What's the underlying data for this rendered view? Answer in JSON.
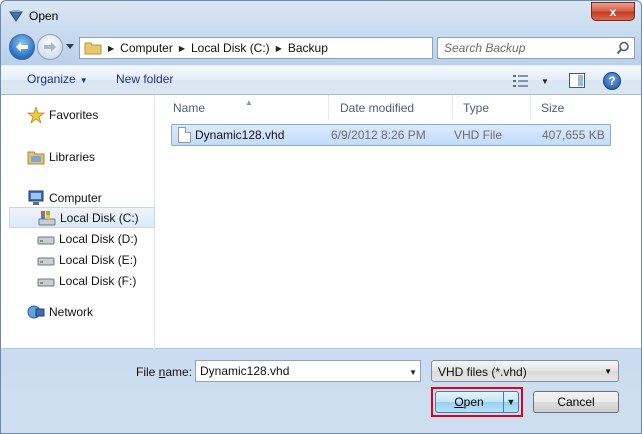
{
  "window": {
    "title": "Open",
    "close_glyph": "x"
  },
  "nav": {
    "back_icon": "back-arrow-icon",
    "breadcrumb": [
      "Computer",
      "Local Disk (C:)",
      "Backup"
    ],
    "search_placeholder": "Search Backup"
  },
  "toolbar": {
    "organize": "Organize",
    "new_folder": "New folder"
  },
  "sidebar": {
    "favorites": "Favorites",
    "libraries": "Libraries",
    "computer": "Computer",
    "drives": [
      "Local Disk (C:)",
      "Local Disk (D:)",
      "Local Disk (E:)",
      "Local Disk (F:)"
    ],
    "network": "Network"
  },
  "columns": {
    "name": "Name",
    "date": "Date modified",
    "type": "Type",
    "size": "Size"
  },
  "files": [
    {
      "name": "Dynamic128.vhd",
      "date": "6/9/2012 8:26 PM",
      "type": "VHD File",
      "size": "407,655 KB"
    }
  ],
  "footer": {
    "filename_label_pre": "File ",
    "filename_label_ul": "n",
    "filename_label_post": "ame:",
    "filename_value": "Dynamic128.vhd",
    "filetype": "VHD files (*.vhd)",
    "open_pre": "",
    "open_ul": "O",
    "open_post": "pen",
    "cancel": "Cancel"
  },
  "colors": {
    "selection": "#c1dcfc",
    "highlight_border": "#e0001b",
    "link_blue": "#1e3287"
  }
}
